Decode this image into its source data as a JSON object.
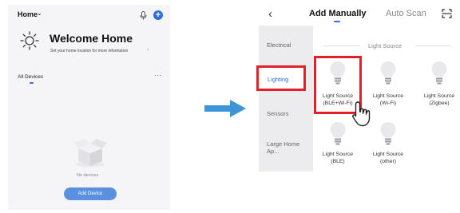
{
  "left": {
    "home_title": "Home",
    "welcome_title": "Welcome Home",
    "welcome_subtitle": "Set your home location for more information",
    "all_devices": "All Devices",
    "more": "···",
    "no_devices": "No devices",
    "add_device": "Add Device"
  },
  "right": {
    "back": "‹",
    "tabs": [
      {
        "label": "Add Manually",
        "active": true
      },
      {
        "label": "Auto Scan",
        "active": false
      }
    ],
    "categories": [
      "Electrical",
      "Lighting",
      "Sensors",
      "Large Home Ap..."
    ],
    "selected_category": "Lighting",
    "section_title": "Light Source",
    "devices": [
      {
        "label_line1": "Light Source",
        "label_line2": "(BLE+Wi-Fi)",
        "highlighted": true
      },
      {
        "label_line1": "Light Source",
        "label_line2": "(Wi-Fi)",
        "highlighted": false
      },
      {
        "label_line1": "Light Source",
        "label_line2": "(Zigbee)",
        "highlighted": false
      },
      {
        "label_line1": "Light Source",
        "label_line2": "(BLE)",
        "highlighted": false
      },
      {
        "label_line1": "Light Source",
        "label_line2": "(other)",
        "highlighted": false
      }
    ]
  },
  "colors": {
    "accent": "#2f6fdb",
    "highlight": "#e0202a",
    "arrow": "#3d94d6"
  }
}
